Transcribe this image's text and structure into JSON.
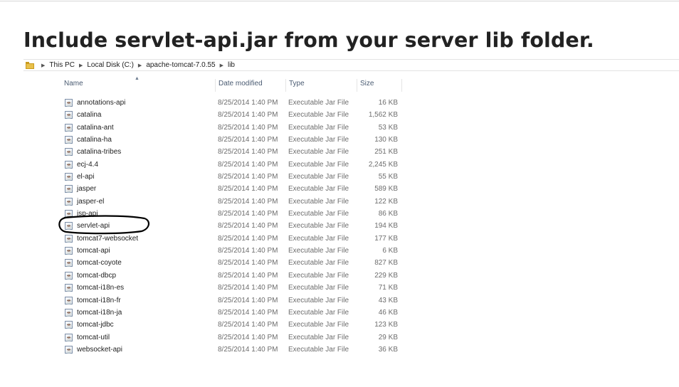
{
  "heading": "Include servlet-api.jar from your server lib folder.",
  "breadcrumb": [
    "This PC",
    "Local Disk (C:)",
    "apache-tomcat-7.0.55",
    "lib"
  ],
  "columns": {
    "name": "Name",
    "date": "Date modified",
    "type": "Type",
    "size": "Size"
  },
  "files": [
    {
      "name": "annotations-api",
      "date": "8/25/2014 1:40 PM",
      "type": "Executable Jar File",
      "size": "16 KB"
    },
    {
      "name": "catalina",
      "date": "8/25/2014 1:40 PM",
      "type": "Executable Jar File",
      "size": "1,562 KB"
    },
    {
      "name": "catalina-ant",
      "date": "8/25/2014 1:40 PM",
      "type": "Executable Jar File",
      "size": "53 KB"
    },
    {
      "name": "catalina-ha",
      "date": "8/25/2014 1:40 PM",
      "type": "Executable Jar File",
      "size": "130 KB"
    },
    {
      "name": "catalina-tribes",
      "date": "8/25/2014 1:40 PM",
      "type": "Executable Jar File",
      "size": "251 KB"
    },
    {
      "name": "ecj-4.4",
      "date": "8/25/2014 1:40 PM",
      "type": "Executable Jar File",
      "size": "2,245 KB"
    },
    {
      "name": "el-api",
      "date": "8/25/2014 1:40 PM",
      "type": "Executable Jar File",
      "size": "55 KB"
    },
    {
      "name": "jasper",
      "date": "8/25/2014 1:40 PM",
      "type": "Executable Jar File",
      "size": "589 KB"
    },
    {
      "name": "jasper-el",
      "date": "8/25/2014 1:40 PM",
      "type": "Executable Jar File",
      "size": "122 KB"
    },
    {
      "name": "jsp-api",
      "date": "8/25/2014 1:40 PM",
      "type": "Executable Jar File",
      "size": "86 KB"
    },
    {
      "name": "servlet-api",
      "date": "8/25/2014 1:40 PM",
      "type": "Executable Jar File",
      "size": "194 KB",
      "highlighted": true
    },
    {
      "name": "tomcat7-websocket",
      "date": "8/25/2014 1:40 PM",
      "type": "Executable Jar File",
      "size": "177 KB"
    },
    {
      "name": "tomcat-api",
      "date": "8/25/2014 1:40 PM",
      "type": "Executable Jar File",
      "size": "6 KB"
    },
    {
      "name": "tomcat-coyote",
      "date": "8/25/2014 1:40 PM",
      "type": "Executable Jar File",
      "size": "827 KB"
    },
    {
      "name": "tomcat-dbcp",
      "date": "8/25/2014 1:40 PM",
      "type": "Executable Jar File",
      "size": "229 KB"
    },
    {
      "name": "tomcat-i18n-es",
      "date": "8/25/2014 1:40 PM",
      "type": "Executable Jar File",
      "size": "71 KB"
    },
    {
      "name": "tomcat-i18n-fr",
      "date": "8/25/2014 1:40 PM",
      "type": "Executable Jar File",
      "size": "43 KB"
    },
    {
      "name": "tomcat-i18n-ja",
      "date": "8/25/2014 1:40 PM",
      "type": "Executable Jar File",
      "size": "46 KB"
    },
    {
      "name": "tomcat-jdbc",
      "date": "8/25/2014 1:40 PM",
      "type": "Executable Jar File",
      "size": "123 KB"
    },
    {
      "name": "tomcat-util",
      "date": "8/25/2014 1:40 PM",
      "type": "Executable Jar File",
      "size": "29 KB"
    },
    {
      "name": "websocket-api",
      "date": "8/25/2014 1:40 PM",
      "type": "Executable Jar File",
      "size": "36 KB"
    }
  ],
  "icons": {
    "folder": "folder-icon",
    "file": "jar-file-icon",
    "separator": "chevron-right-icon",
    "sort": "sort-ascending-icon"
  },
  "colors": {
    "highlight_ink": "#000000",
    "folder": "#e8c04a",
    "header_text": "#4a5b72"
  }
}
